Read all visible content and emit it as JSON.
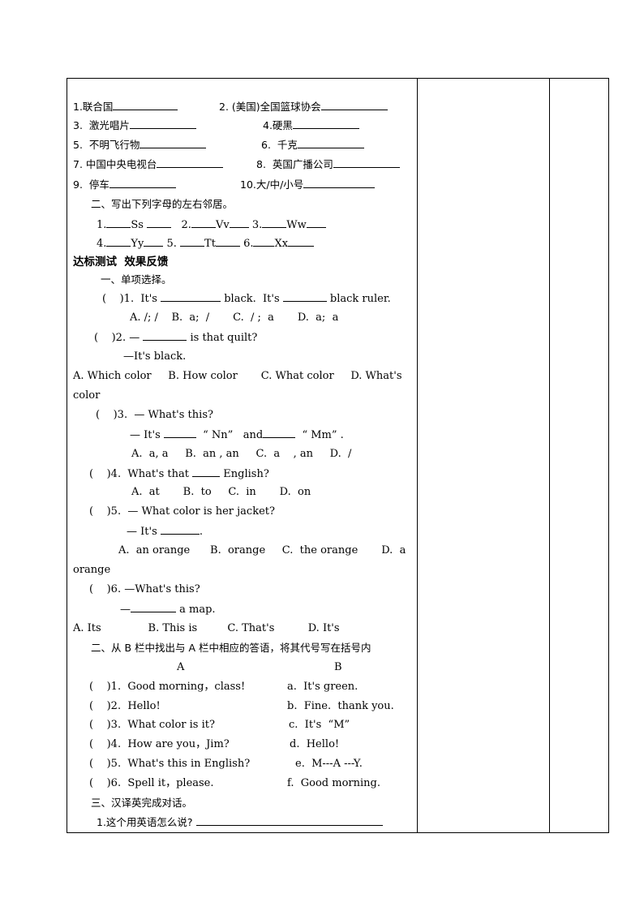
{
  "vocab": {
    "items": [
      {
        "label": "1.联合国"
      },
      {
        "label": "2. (美国)全国篮球协会"
      },
      {
        "label": "3.  激光唱片"
      },
      {
        "label": "4.硬黑"
      },
      {
        "label": "5.  不明飞行物"
      },
      {
        "label": "6.  千克"
      },
      {
        "label": "7. 中国中央电视台"
      },
      {
        "label": "8.  英国广播公司"
      },
      {
        "label": "9.  停车"
      },
      {
        "label": "10.大/中/小号"
      }
    ]
  },
  "letters": {
    "heading": "二、写出下列字母的左右邻居。",
    "row1": [
      "1.",
      "Ss",
      "2.",
      "Vv",
      "3.",
      "Ww"
    ],
    "row2": [
      "4.",
      "Yy",
      "5.",
      "Tt",
      "6.",
      "Xx"
    ]
  },
  "test": {
    "heading": "达标测试  效果反馈",
    "section1": "一、单项选择。",
    "q1": {
      "prefix": "(    )1.  It's",
      "mid": "black.  It's",
      "end": "black ruler.",
      "options": "A. /; /    B.  a;  ∕       C.  ∕ ;  a       D.  a;  a"
    },
    "q2": {
      "prefix": "(    )2. —",
      "end": "is that quilt?",
      "answer": "—It's black.",
      "options": "A. Which color     B. How color       C. What color     D. What's",
      "wrap": "color"
    },
    "q3": {
      "line1": "(    )3.  — What's this?",
      "prefix": "— It's",
      "mid": "“ Nn”   and",
      "end": "“ Mm” .",
      "options": "A.  a, a     B.  an , an     C.  a    , an     D.  ∕"
    },
    "q4": {
      "prefix": "(    )4.  What's that",
      "end": "English?",
      "options": "A.  at       B.  to     C.  in       D.  on"
    },
    "q5": {
      "line1": "(    )5.  — What color is her jacket?",
      "prefix": "— It's",
      "end": ".",
      "options": "A.  an orange      B.  orange     C.  the orange       D.  a",
      "wrap": "orange"
    },
    "q6": {
      "line1": "(    )6. —What's this?",
      "prefix": "—",
      "end": "a map.",
      "options": "A. Its              B. This is         C. That's          D. It's"
    }
  },
  "matching": {
    "heading": "二、从 B 栏中找出与 A 栏中相应的答语，将其代号写在括号内",
    "colA": "A",
    "colB": "B",
    "rows": [
      {
        "a": "(    )1.  Good morning，class!",
        "b": "a.  It's green."
      },
      {
        "a": "(    )2.  Hello!",
        "b": "b.  Fine.  thank you."
      },
      {
        "a": "(    )3.  What color is it?",
        "b": "c.  It's  “M”"
      },
      {
        "a": "(    )4.  How are you，Jim?",
        "b": "d.  Hello!"
      },
      {
        "a": "(    )5.  What's this in English?",
        "b": "e.  M---A ---Y."
      },
      {
        "a": "(    )6.  Spell it，please.",
        "b": "f.  Good morning."
      }
    ]
  },
  "translate": {
    "heading": "三、汉译英完成对话。",
    "q1": "1.这个用英语怎么说?"
  }
}
